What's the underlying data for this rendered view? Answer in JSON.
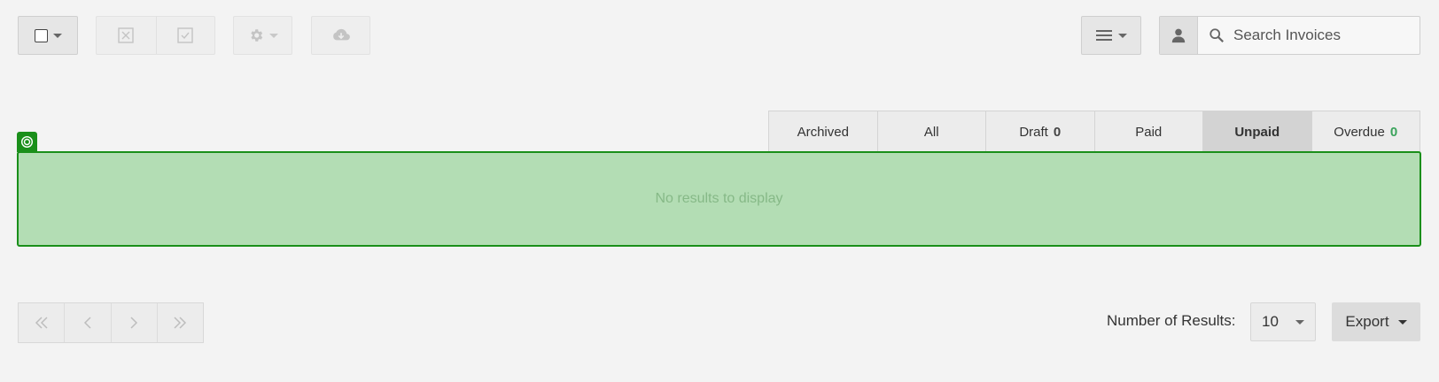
{
  "toolbar": {
    "icons": [
      "checkbox-icon",
      "reject-icon",
      "approve-icon",
      "gear-icon",
      "cloud-download-icon",
      "list-menu-icon",
      "user-icon",
      "search-icon"
    ]
  },
  "search": {
    "placeholder": "Search Invoices"
  },
  "tabs": [
    {
      "label": "Archived",
      "count": ""
    },
    {
      "label": "All",
      "count": ""
    },
    {
      "label": "Draft",
      "count": "0"
    },
    {
      "label": "Paid",
      "count": ""
    },
    {
      "label": "Unpaid",
      "count": "",
      "active": true
    },
    {
      "label": "Overdue",
      "count": "0"
    }
  ],
  "results": {
    "empty_text": "No results to display"
  },
  "footer": {
    "results_label": "Number of Results:",
    "results_value": "10",
    "export_label": "Export"
  },
  "colors": {
    "accent_green": "#1a8f1a",
    "panel_green": "#b3ddb4",
    "count_green": "#3aa35b"
  }
}
